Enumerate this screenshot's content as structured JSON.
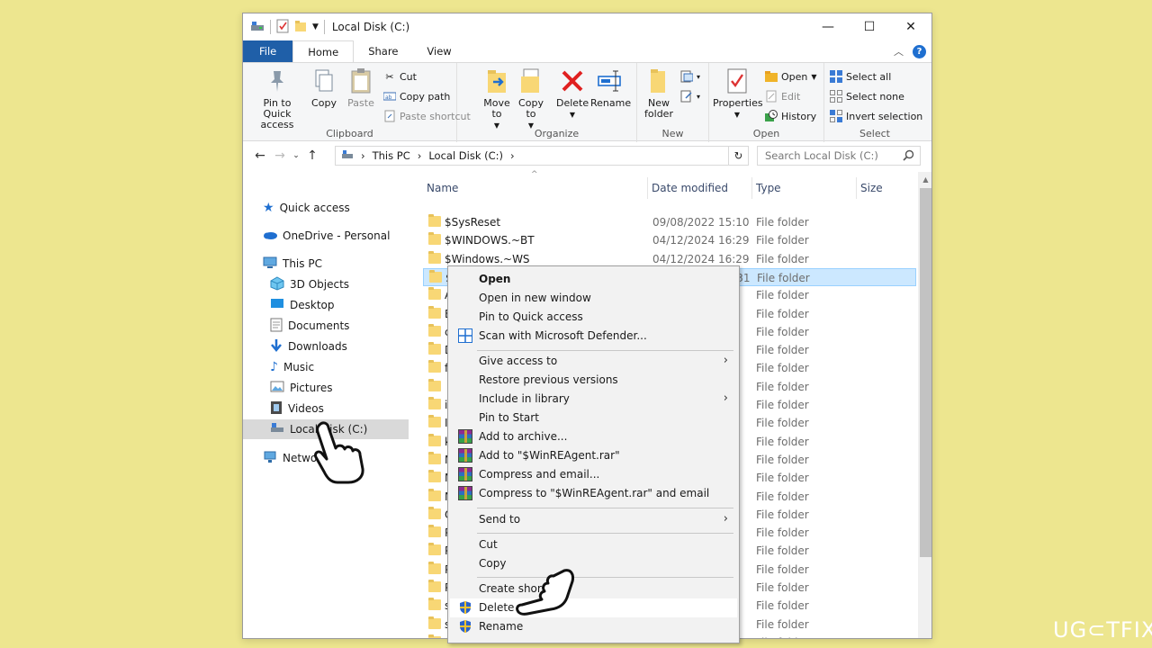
{
  "window": {
    "title": "Local Disk (C:)",
    "controls": {
      "minimize": "—",
      "maximize": "☐",
      "close": "✕"
    }
  },
  "ribbon_tabs": [
    "File",
    "Home",
    "Share",
    "View"
  ],
  "ribbon": {
    "clipboard": {
      "label": "Clipboard",
      "pin": "Pin to Quick access",
      "copy": "Copy",
      "paste": "Paste",
      "cut": "Cut",
      "copy_path": "Copy path",
      "paste_shortcut": "Paste shortcut"
    },
    "organize": {
      "label": "Organize",
      "move_to": "Move to",
      "copy_to": "Copy to",
      "delete": "Delete",
      "rename": "Rename"
    },
    "new": {
      "label": "New",
      "new_folder": "New folder"
    },
    "open": {
      "label": "Open",
      "properties": "Properties",
      "open": "Open",
      "edit": "Edit",
      "history": "History"
    },
    "select": {
      "label": "Select",
      "select_all": "Select all",
      "select_none": "Select none",
      "invert": "Invert selection"
    }
  },
  "address": {
    "crumbs": [
      "This PC",
      "Local Disk (C:)"
    ],
    "search_placeholder": "Search Local Disk (C:)"
  },
  "nav": {
    "quick_access": "Quick access",
    "onedrive": "OneDrive - Personal",
    "this_pc": "This PC",
    "objects3d": "3D Objects",
    "desktop": "Desktop",
    "documents": "Documents",
    "downloads": "Downloads",
    "music": "Music",
    "pictures": "Pictures",
    "videos": "Videos",
    "local_disk": "Local Disk (C:)",
    "network": "Network"
  },
  "columns": {
    "name": "Name",
    "date": "Date modified",
    "type": "Type",
    "size": "Size"
  },
  "files": [
    {
      "name": "$SysReset",
      "date": "09/08/2022 15:10",
      "type": "File folder"
    },
    {
      "name": "$WINDOWS.~BT",
      "date": "04/12/2024 16:29",
      "type": "File folder"
    },
    {
      "name": "$Windows.~WS",
      "date": "04/12/2024 16:29",
      "type": "File folder"
    },
    {
      "name": "$WinREAgent",
      "date": "16/01/2025 11:31",
      "type": "File folder"
    },
    {
      "name": "A",
      "date": "",
      "type": "File folder"
    },
    {
      "name": "B",
      "date": "",
      "type": "File folder"
    },
    {
      "name": "c",
      "date": "",
      "type": "File folder"
    },
    {
      "name": "D",
      "date": "",
      "type": "File folder"
    },
    {
      "name": "f",
      "date": "",
      "type": "File folder"
    },
    {
      "name": "",
      "date": "",
      "type": "File folder"
    },
    {
      "name": "i",
      "date": "",
      "type": "File folder"
    },
    {
      "name": "I",
      "date": "",
      "type": "File folder"
    },
    {
      "name": "k",
      "date": "",
      "type": "File folder"
    },
    {
      "name": "N",
      "date": "",
      "type": "File folder"
    },
    {
      "name": "N",
      "date": "",
      "type": "File folder"
    },
    {
      "name": "N",
      "date": "",
      "type": "File folder"
    },
    {
      "name": "O",
      "date": "",
      "type": "File folder"
    },
    {
      "name": "P",
      "date": "",
      "type": "File folder"
    },
    {
      "name": "P",
      "date": "",
      "type": "File folder"
    },
    {
      "name": "P",
      "date": "",
      "type": "File folder"
    },
    {
      "name": "P",
      "date": "",
      "type": "File folder"
    },
    {
      "name": "s",
      "date": "",
      "type": "File folder"
    },
    {
      "name": "s",
      "date": "",
      "type": "File folder"
    },
    {
      "name": "T",
      "date": "",
      "type": "File folder"
    }
  ],
  "context_menu": {
    "open": "Open",
    "open_new_window": "Open in new window",
    "pin_quick": "Pin to Quick access",
    "scan": "Scan with Microsoft Defender...",
    "give_access": "Give access to",
    "restore": "Restore previous versions",
    "include_library": "Include in library",
    "pin_start": "Pin to Start",
    "add_archive": "Add to archive...",
    "add_rar": "Add to \"$WinREAgent.rar\"",
    "compress_email": "Compress and email...",
    "compress_rar_email": "Compress to \"$WinREAgent.rar\" and email",
    "send_to": "Send to",
    "cut": "Cut",
    "copy": "Copy",
    "create_shortcut": "Create shor",
    "delete": "Delete",
    "rename": "Rename"
  },
  "watermark": "UG⊂TFIX",
  "colors": {
    "accent": "#1f5fa8",
    "selection": "#cce8ff",
    "background": "#ede68f"
  }
}
